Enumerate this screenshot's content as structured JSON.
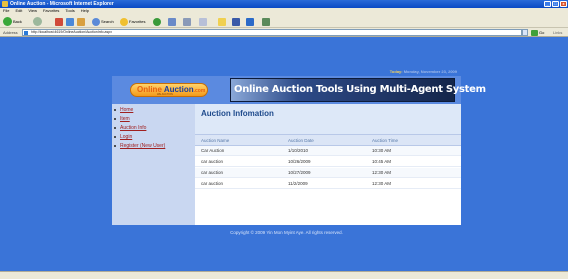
{
  "window": {
    "title": "Online Auction - Microsoft Internet Explorer"
  },
  "menu": [
    "File",
    "Edit",
    "View",
    "Favorites",
    "Tools",
    "Help"
  ],
  "toolbar": {
    "back_label": "Back",
    "search_label": "Search",
    "favorites_label": "Favorites"
  },
  "address": {
    "label": "Address",
    "url": "http://localhost:4619/OnlineAuction/AuctionInfo.aspx",
    "go_label": "Go",
    "links_label": "Links"
  },
  "site": {
    "today_label": "Today",
    "today_value": "Monday, November 23, 2009",
    "logo_text_a": "Online",
    "logo_text_b": " Auction",
    "logo_text_c": ".com",
    "logo_sub": "WE AUCTION",
    "banner_title": "Online Auction Tools Using Multi-Agent System",
    "nav": [
      "Home",
      "Item",
      "Auction Info",
      "Login",
      "Register (New User)"
    ],
    "page_title": "Auction Infomation",
    "columns": [
      "Auction Name",
      "Auction Date",
      "Auction Time"
    ],
    "rows": [
      [
        "Car Auction",
        "1/10/2010",
        "10:30 AM"
      ],
      [
        "car auction",
        "10/26/2009",
        "10:45 AM"
      ],
      [
        "car auction",
        "10/27/2009",
        "12:30 AM"
      ],
      [
        "car auction",
        "11/2/2009",
        "12:30 AM"
      ]
    ],
    "copyright": "Copyright © 2009 Yin Mon Myint Aye. All rights reserved."
  },
  "colors": {
    "page_bg": "#3a74d8",
    "sidebar_bg": "#c9d7f1",
    "title_color": "#1e4a8c",
    "nav_link": "#a02020"
  }
}
